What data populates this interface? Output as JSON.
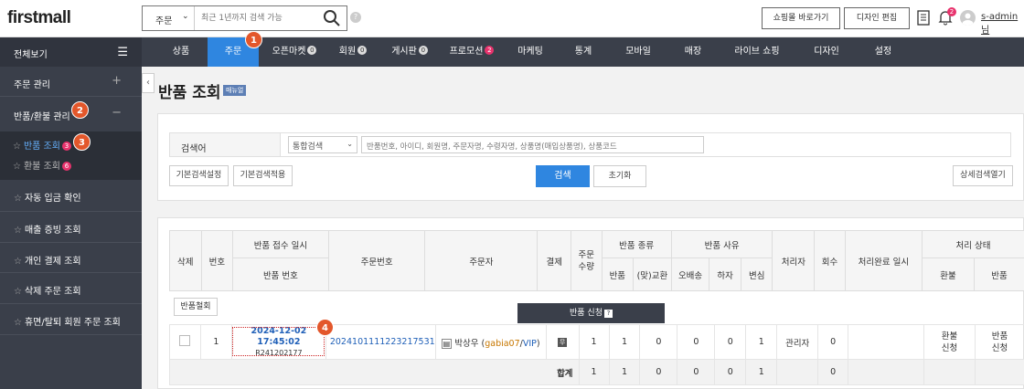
{
  "brand": "firstmall",
  "search": {
    "scope": "주문",
    "placeholder": "최근 1년까지 검색 가능"
  },
  "top_buttons": {
    "mall": "쇼핑몰 바로가기",
    "design": "디자인 편집"
  },
  "notification_count": "2",
  "admin_user": "s-admin님",
  "nav": {
    "all_view": "전체보기",
    "items": [
      {
        "label": "상품"
      },
      {
        "label": "주문",
        "badge": "1"
      },
      {
        "label": "오픈마켓",
        "badge": "0"
      },
      {
        "label": "회원",
        "badge": "0"
      },
      {
        "label": "게시판",
        "badge": "0"
      },
      {
        "label": "프로모션",
        "badge": "2"
      },
      {
        "label": "마케팅"
      },
      {
        "label": "통계"
      },
      {
        "label": "모바일"
      },
      {
        "label": "매장"
      },
      {
        "label": "라이브 쇼핑"
      },
      {
        "label": "디자인"
      },
      {
        "label": "설정"
      }
    ]
  },
  "sidebar": {
    "order_mgmt": "주문 관리",
    "return_mgmt": "반품/환불 관리",
    "sub": [
      {
        "label": "반품 조회",
        "badge": "3"
      },
      {
        "label": "환불 조회",
        "badge": "6"
      }
    ],
    "items": [
      "자동 입금 확인",
      "매출 증빙 조회",
      "개인 결제 조회",
      "삭제 주문 조회",
      "휴면/탈퇴 회원 주문 조회"
    ]
  },
  "page": {
    "title": "반품 조회",
    "manual": "매뉴얼"
  },
  "search_form": {
    "label": "검색어",
    "select": "통합검색",
    "input_placeholder": "반품번호, 아이디, 회원명, 주문자명, 수령자명, 상품명(매입상품명), 상품코드",
    "basic_settings": "기본검색설정",
    "apply_basic": "기본검색적용",
    "submit": "검색",
    "reset": "초기화",
    "advanced": "상세검색열기"
  },
  "table": {
    "headers": {
      "delete": "삭제",
      "no": "번호",
      "received": "반품 접수 일시",
      "return_no": "반품 번호",
      "order_no": "주문번호",
      "orderer": "주문자",
      "payment": "결제",
      "qty": "주문\n수량",
      "type": "반품 종류",
      "type_return": "반품",
      "type_exchange": "(맞)교환",
      "reason": "반품 사유",
      "reason_mis": "오배송",
      "reason_defect": "하자",
      "reason_change": "변심",
      "handler": "처리자",
      "count": "회수",
      "done_time": "처리완료 일시",
      "status": "처리 상태",
      "status_refund": "환불",
      "status_return": "반품"
    },
    "cancel_btn": "반품철회",
    "apply_bar": "반품 신청",
    "row": {
      "no": "1",
      "date": "2024-12-02 17:45:02",
      "return_no": "R241202177",
      "order_no": "2024101111223217531",
      "orderer": "박상우",
      "orderer_id": "gabia07",
      "orderer_grade": "VIP",
      "payment": "무",
      "qty": "1",
      "type_return": "1",
      "type_exchange": "0",
      "reason_mis": "0",
      "reason_defect": "0",
      "reason_change": "1",
      "handler": "관리자",
      "count": "0",
      "status_refund": "환불\n신청",
      "status_return": "반품\n신청"
    },
    "total": {
      "label": "합계",
      "qty": "1",
      "type_return": "1",
      "type_exchange": "0",
      "reason_mis": "0",
      "reason_defect": "0",
      "reason_change": "1",
      "count": "0"
    }
  },
  "callouts": [
    "1",
    "2",
    "3",
    "4"
  ]
}
